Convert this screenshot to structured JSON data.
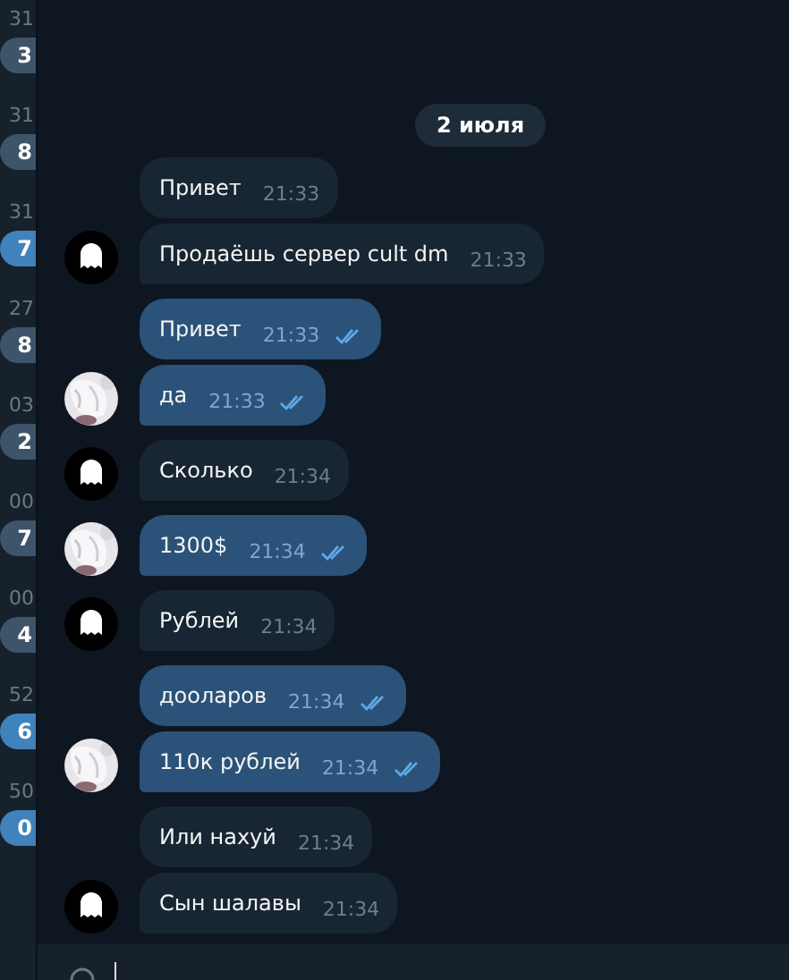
{
  "sidebar": {
    "chats": [
      {
        "time": "31",
        "badge": "3",
        "unmuted": false
      },
      {
        "time": "31",
        "badge": "8",
        "unmuted": false
      },
      {
        "time": "31",
        "badge": "7",
        "unmuted": true
      },
      {
        "time": "27",
        "badge": "8",
        "unmuted": false
      },
      {
        "time": "03",
        "badge": "2",
        "unmuted": false
      },
      {
        "time": "00",
        "badge": "7",
        "unmuted": false
      },
      {
        "time": "00",
        "badge": "4",
        "unmuted": false
      },
      {
        "time": "52",
        "badge": "6",
        "unmuted": true
      },
      {
        "time": "50",
        "badge": "0",
        "unmuted": true
      }
    ]
  },
  "chat": {
    "date": "2 июля",
    "messages": [
      {
        "text": "Привет",
        "time": "21:33",
        "outgoing": false,
        "avatar": false
      },
      {
        "text": "Продаёшь сервер cult dm",
        "time": "21:33",
        "outgoing": false,
        "avatar": true
      },
      {
        "text": "Привет",
        "time": "21:33",
        "outgoing": true,
        "avatar": false
      },
      {
        "text": "да",
        "time": "21:33",
        "outgoing": true,
        "avatar": true
      },
      {
        "text": "Сколько",
        "time": "21:34",
        "outgoing": false,
        "avatar": true
      },
      {
        "text": "1300$",
        "time": "21:34",
        "outgoing": true,
        "avatar": true
      },
      {
        "text": "Рублей",
        "time": "21:34",
        "outgoing": false,
        "avatar": true
      },
      {
        "text": "дооларов",
        "time": "21:34",
        "outgoing": true,
        "avatar": false
      },
      {
        "text": "110к рублей",
        "time": "21:34",
        "outgoing": true,
        "avatar": true
      },
      {
        "text": "Или нахуй",
        "time": "21:34",
        "outgoing": false,
        "avatar": false
      },
      {
        "text": "Сын шалавы",
        "time": "21:34",
        "outgoing": false,
        "avatar": true
      }
    ]
  }
}
